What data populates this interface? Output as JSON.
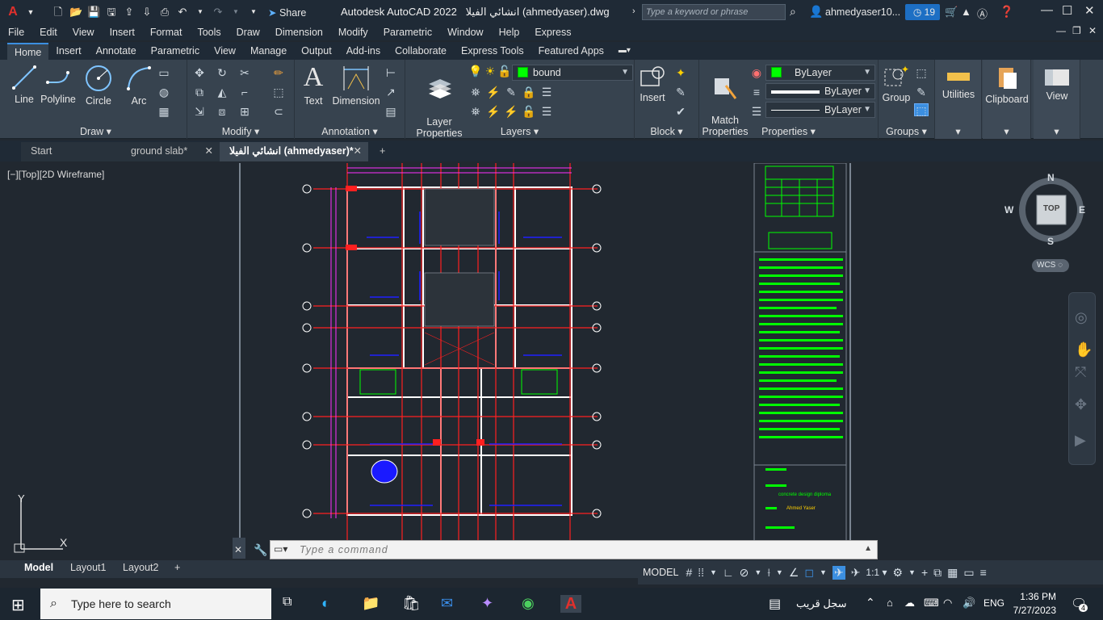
{
  "app": {
    "title": "Autodesk AutoCAD 2022",
    "filename": "انشائي الفيلا (ahmedyaser).dwg",
    "share_label": "Share",
    "search_placeholder": "Type a keyword or phrase",
    "user": "ahmedyaser10...",
    "notifications": "19"
  },
  "menu": [
    "File",
    "Edit",
    "View",
    "Insert",
    "Format",
    "Tools",
    "Draw",
    "Dimension",
    "Modify",
    "Parametric",
    "Window",
    "Help",
    "Express"
  ],
  "ribbon_tabs": [
    "Home",
    "Insert",
    "Annotate",
    "Parametric",
    "View",
    "Manage",
    "Output",
    "Add-ins",
    "Collaborate",
    "Express Tools",
    "Featured Apps"
  ],
  "ribbon": {
    "draw": {
      "title": "Draw",
      "buttons": [
        "Line",
        "Polyline",
        "Circle",
        "Arc"
      ]
    },
    "modify": {
      "title": "Modify"
    },
    "annotation": {
      "title": "Annotation",
      "text": "Text",
      "dimension": "Dimension"
    },
    "layers": {
      "title": "Layers",
      "layer_properties": "Layer\nProperties",
      "current_layer": "bound",
      "layer_color": "#00ff00"
    },
    "block": {
      "title": "Block",
      "insert": "Insert"
    },
    "properties": {
      "title": "Properties",
      "match": "Match\nProperties",
      "color": "ByLayer",
      "linetype": "ByLayer",
      "lineweight": "ByLayer"
    },
    "groups": {
      "title": "Groups",
      "group": "Group"
    },
    "utilities": "Utilities",
    "clipboard": "Clipboard",
    "view": "View"
  },
  "file_tabs": [
    "Start",
    "ground slab*",
    "انشائي الفيلا (ahmedyaser)*"
  ],
  "viewport_label": "[−][Top][2D Wireframe]",
  "viewcube": {
    "top": "TOP",
    "n": "N",
    "s": "S",
    "e": "E",
    "w": "W",
    "wcs": "WCS"
  },
  "drawing_texts": {
    "design_title": "concrete design diploma",
    "designer": "Ahmed Yaser"
  },
  "ucs": {
    "x": "X",
    "y": "Y"
  },
  "command_placeholder": "Type  a  command",
  "layout_tabs": [
    "Model",
    "Layout1",
    "Layout2"
  ],
  "status": {
    "model": "MODEL",
    "scale": "1:1"
  },
  "taskbar": {
    "search": "Type here to search",
    "weather": "سجل قريب",
    "lang": "ENG",
    "time": "1:36 PM",
    "date": "7/27/2023",
    "notif": "4"
  }
}
